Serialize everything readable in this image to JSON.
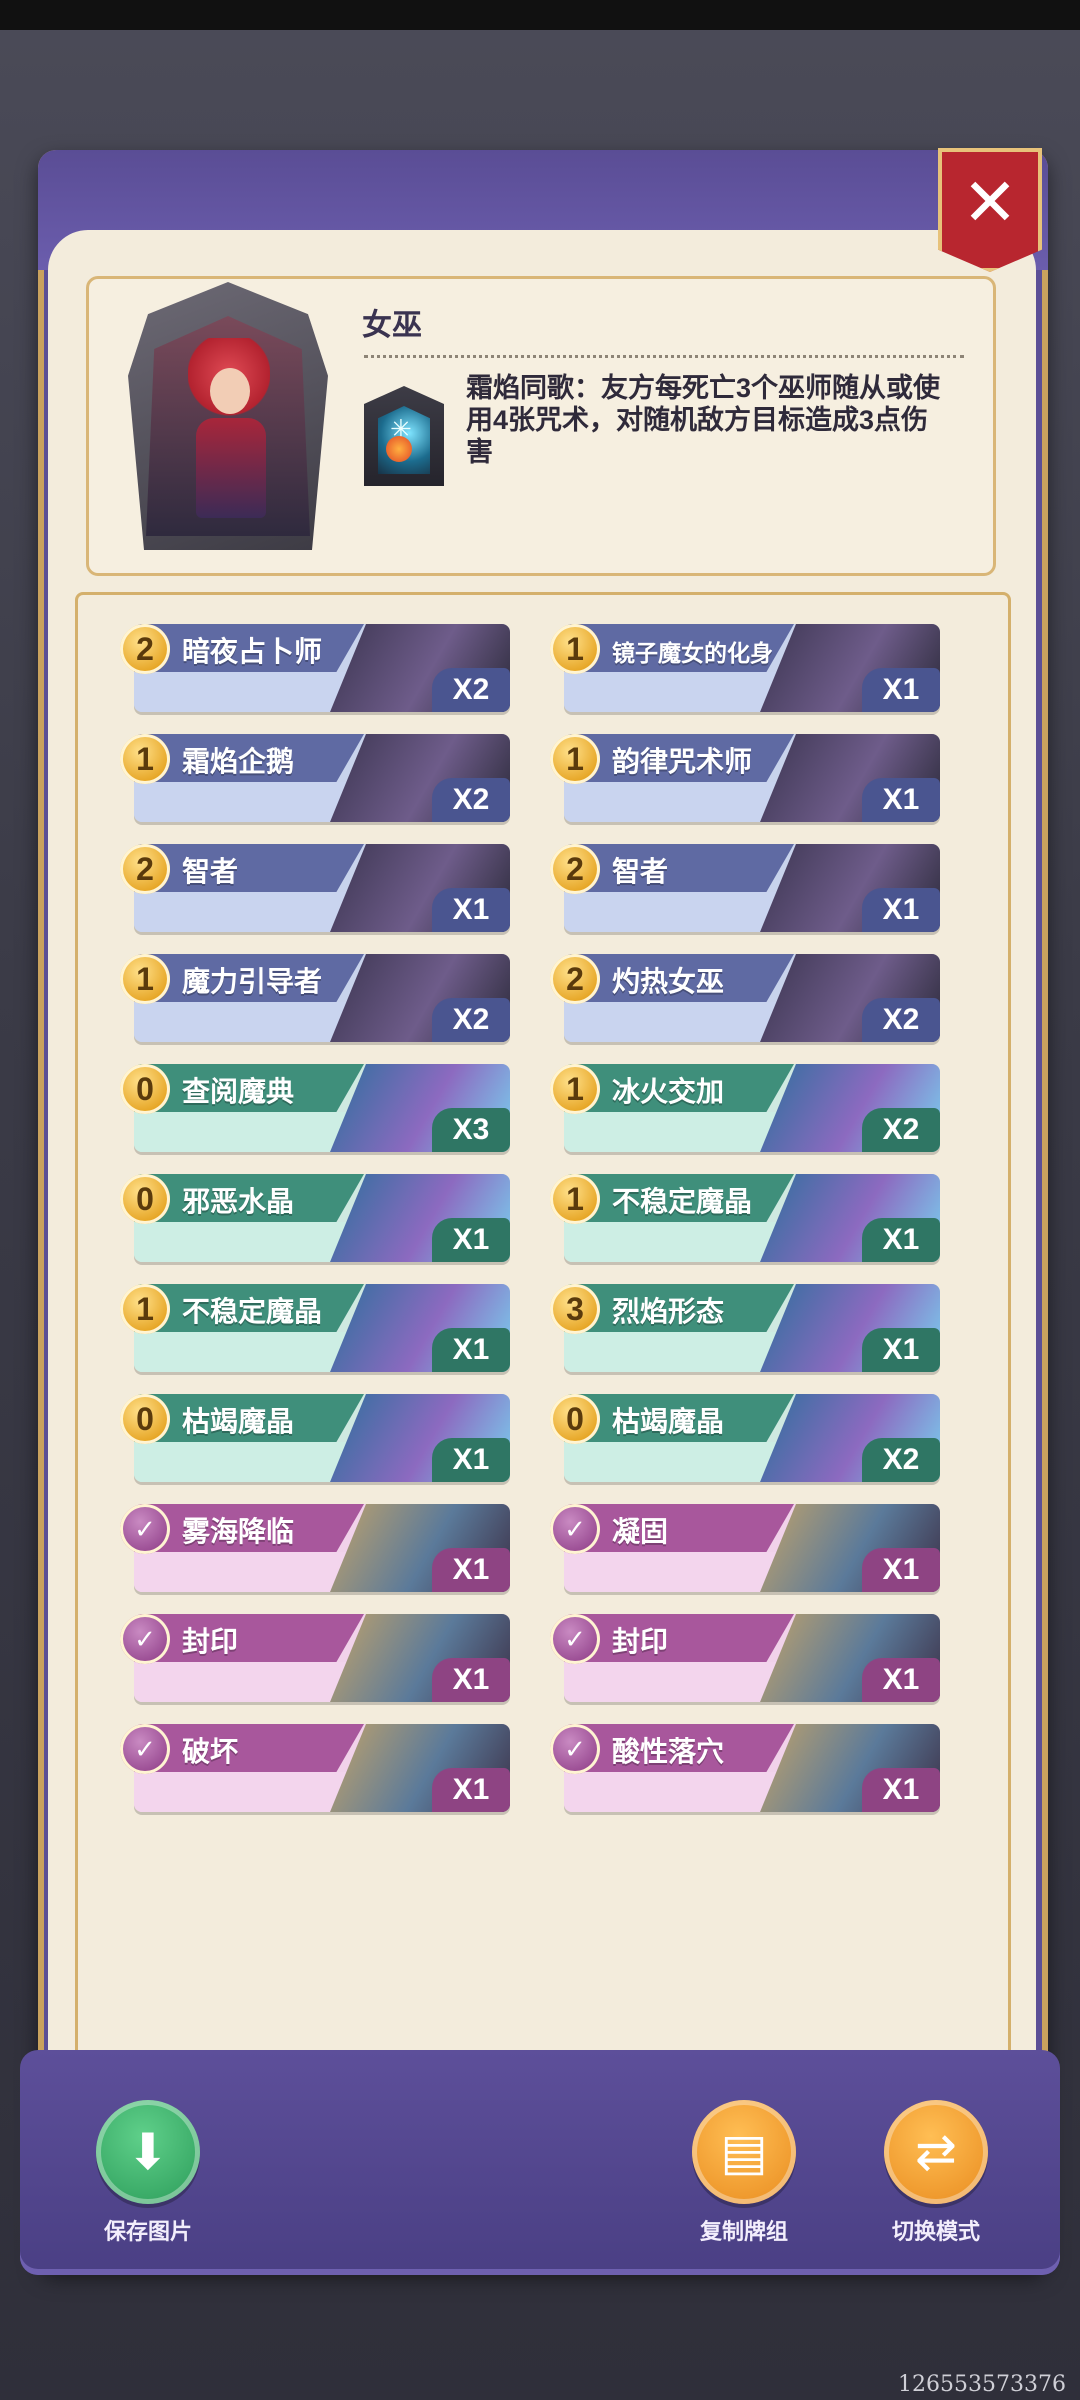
{
  "hero": {
    "name": "女巫",
    "skill": "霜焰同歌：友方每死亡3个巫师随从或使用4张咒术，对随机敌方目标造成3点伤害"
  },
  "close_label": "✕",
  "cards_left": [
    {
      "cost": "2",
      "name": "暗夜占卜师",
      "count": "X2",
      "theme": "blue"
    },
    {
      "cost": "1",
      "name": "霜焰企鹅",
      "count": "X2",
      "theme": "blue"
    },
    {
      "cost": "2",
      "name": "智者",
      "count": "X1",
      "theme": "blue"
    },
    {
      "cost": "1",
      "name": "魔力引导者",
      "count": "X2",
      "theme": "blue"
    },
    {
      "cost": "0",
      "name": "查阅魔典",
      "count": "X3",
      "theme": "teal"
    },
    {
      "cost": "0",
      "name": "邪恶水晶",
      "count": "X1",
      "theme": "teal"
    },
    {
      "cost": "1",
      "name": "不稳定魔晶",
      "count": "X1",
      "theme": "teal"
    },
    {
      "cost": "0",
      "name": "枯竭魔晶",
      "count": "X1",
      "theme": "teal"
    },
    {
      "cost": "✓",
      "name": "雾海降临",
      "count": "X1",
      "theme": "pink"
    },
    {
      "cost": "✓",
      "name": "封印",
      "count": "X1",
      "theme": "pink"
    },
    {
      "cost": "✓",
      "name": "破坏",
      "count": "X1",
      "theme": "pink"
    }
  ],
  "cards_right": [
    {
      "cost": "1",
      "name": "镜子魔女的化身",
      "count": "X1",
      "theme": "blue"
    },
    {
      "cost": "1",
      "name": "韵律咒术师",
      "count": "X1",
      "theme": "blue"
    },
    {
      "cost": "2",
      "name": "智者",
      "count": "X1",
      "theme": "blue"
    },
    {
      "cost": "2",
      "name": "灼热女巫",
      "count": "X2",
      "theme": "blue"
    },
    {
      "cost": "1",
      "name": "冰火交加",
      "count": "X2",
      "theme": "teal"
    },
    {
      "cost": "1",
      "name": "不稳定魔晶",
      "count": "X1",
      "theme": "teal"
    },
    {
      "cost": "3",
      "name": "烈焰形态",
      "count": "X1",
      "theme": "teal"
    },
    {
      "cost": "0",
      "name": "枯竭魔晶",
      "count": "X2",
      "theme": "teal"
    },
    {
      "cost": "✓",
      "name": "凝固",
      "count": "X1",
      "theme": "pink"
    },
    {
      "cost": "✓",
      "name": "封印",
      "count": "X1",
      "theme": "pink"
    },
    {
      "cost": "✓",
      "name": "酸性落穴",
      "count": "X1",
      "theme": "pink"
    }
  ],
  "buttons": {
    "save": {
      "label": "保存图片",
      "icon": "download-icon",
      "color": "#2a9a58"
    },
    "copy": {
      "label": "复制牌组",
      "icon": "copy-icon",
      "color": "#e88a1d"
    },
    "switch": {
      "label": "切换模式",
      "icon": "swap-icon",
      "color": "#e88a1d"
    }
  },
  "footer_id": "126553573376"
}
